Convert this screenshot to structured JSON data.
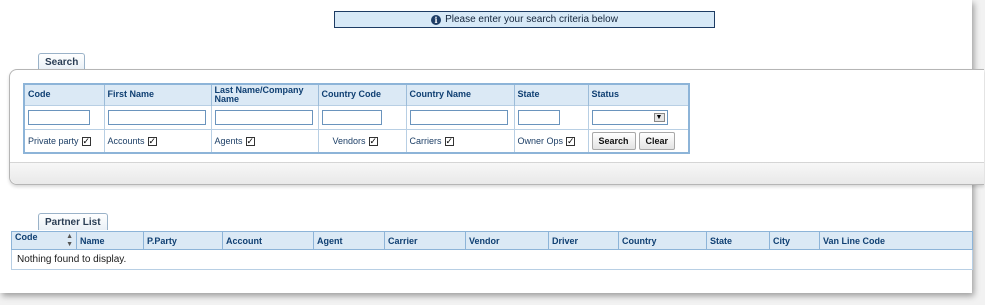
{
  "banner": {
    "icon": "info-icon",
    "text": "Please enter your search criteria below"
  },
  "search_tab": {
    "label": "Search"
  },
  "search": {
    "headers": [
      "Code",
      "First Name",
      "Last Name/Company Name",
      "Country Code",
      "Country Name",
      "State",
      "Status"
    ],
    "inputs": {
      "code": "",
      "first_name": "",
      "last_name": "",
      "country_code": "",
      "country_name": "",
      "state": "",
      "status": ""
    },
    "checkboxes": [
      {
        "label": "Private party",
        "checked": true
      },
      {
        "label": "Accounts",
        "checked": true
      },
      {
        "label": "Agents",
        "checked": true
      },
      {
        "label": "Vendors",
        "checked": true
      },
      {
        "label": "Carriers",
        "checked": true
      },
      {
        "label": "Owner Ops",
        "checked": true
      }
    ],
    "search_button": "Search",
    "clear_button": "Clear"
  },
  "partner_tab": {
    "label": "Partner List"
  },
  "partner_list": {
    "columns": [
      "Code",
      "Name",
      "P.Party",
      "Account",
      "Agent",
      "Carrier",
      "Vendor",
      "Driver",
      "Country",
      "State",
      "City",
      "Van Line Code"
    ],
    "empty_message": "Nothing found to display."
  }
}
